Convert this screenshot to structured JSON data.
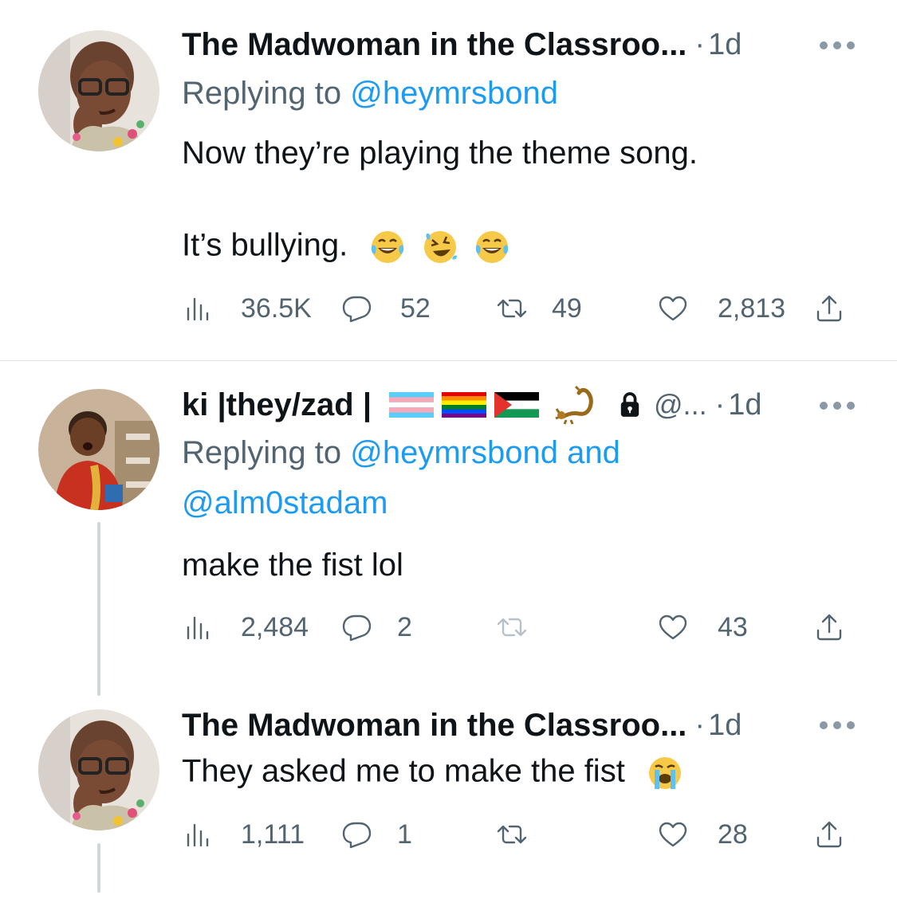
{
  "tweets": [
    {
      "author": "The Madwoman in the Classroo...",
      "time": "1d",
      "replying_prefix": "Replying to",
      "replying_to": "@heymrsbond",
      "text_line1": "Now they’re playing the theme song.",
      "text_line2": "It’s bullying.",
      "emojis": [
        "face-with-tears-of-joy",
        "rolling-on-floor-laughing",
        "face-with-tears-of-joy"
      ],
      "stats": {
        "views": "36.5K",
        "replies": "52",
        "retweets": "49",
        "likes": "2,813"
      }
    },
    {
      "author": "ki |they/zad |",
      "author_badges": [
        "transgender-flag",
        "rainbow-flag",
        "palestine-flag",
        "scorpion",
        "lock"
      ],
      "handle": "@...",
      "time": "1d",
      "replying_prefix": "Replying to",
      "replying_to": "@heymrsbond",
      "replying_and": "and",
      "replying_to_2": "@alm0stadam",
      "text_line1": "make the fist lol",
      "stats": {
        "views": "2,484",
        "replies": "2",
        "retweets": "",
        "likes": "43"
      }
    },
    {
      "author": "The Madwoman in the Classroo...",
      "time": "1d",
      "text_line1": "They asked me to make the fist",
      "emojis": [
        "loudly-crying-face"
      ],
      "stats": {
        "views": "1,111",
        "replies": "1",
        "retweets": "",
        "likes": "28"
      }
    }
  ],
  "separator": "·",
  "colors": {
    "link": "#1d9bf0",
    "muted": "#536471",
    "text": "#0f1419",
    "divider": "#dfe3e7"
  }
}
